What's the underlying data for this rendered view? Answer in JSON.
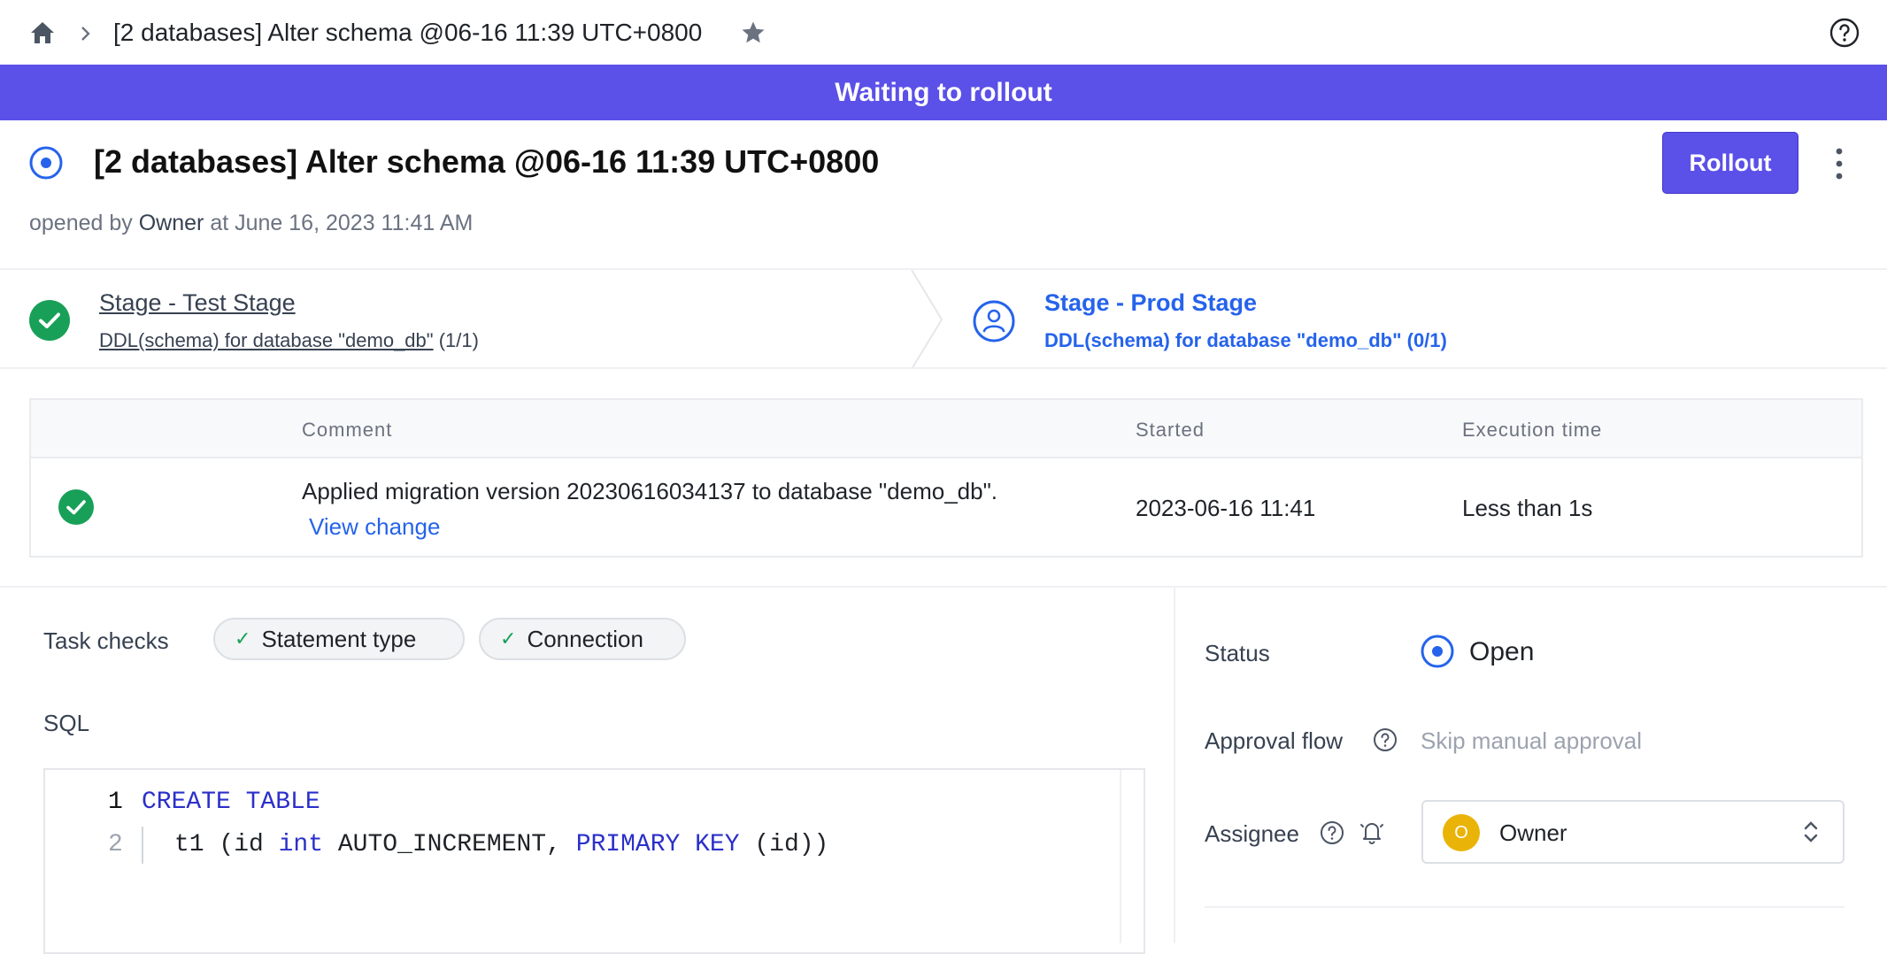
{
  "header": {
    "breadcrumb_title": "[2 databases] Alter schema @06-16 11:39 UTC+0800"
  },
  "banner": {
    "text": "Waiting to rollout"
  },
  "issue": {
    "title": "[2 databases] Alter schema @06-16 11:39 UTC+0800",
    "opened_prefix": "opened by",
    "opened_user": "Owner",
    "opened_time": "at June 16, 2023 11:41 AM",
    "rollout_label": "Rollout"
  },
  "stages": [
    {
      "title": "Stage - Test Stage",
      "task": "DDL(schema) for database \"demo_db\"",
      "count": "(1/1)"
    },
    {
      "title": "Stage - Prod Stage",
      "task": "DDL(schema) for database \"demo_db\"",
      "count": "(0/1)"
    }
  ],
  "task_runs": {
    "headers": {
      "comment": "Comment",
      "started": "Started",
      "execution_time": "Execution time"
    },
    "rows": [
      {
        "comment": "Applied migration version 20230616034137 to database \"demo_db\".",
        "link": "View change",
        "started": "2023-06-16 11:41",
        "execution_time": "Less than 1s"
      }
    ]
  },
  "task_checks": {
    "label": "Task checks",
    "chips": [
      "Statement type",
      "Connection"
    ]
  },
  "sql": {
    "label": "SQL",
    "lines": [
      {
        "num": "1",
        "kw": "CREATE TABLE"
      },
      {
        "num": "2",
        "t1": "t1 (id ",
        "kw1": "int",
        "t2": " AUTO_INCREMENT, ",
        "kw2": "PRIMARY KEY",
        "t3": " (id))"
      }
    ]
  },
  "sidebar": {
    "status_label": "Status",
    "status_value": "Open",
    "approval_label": "Approval flow",
    "approval_value": "Skip manual approval",
    "assignee_label": "Assignee",
    "assignee_initial": "O",
    "assignee_value": "Owner"
  },
  "colors": {
    "accent": "#5b50e8",
    "success": "#18a058",
    "link": "#2563eb",
    "keyword": "#2b30c9"
  }
}
